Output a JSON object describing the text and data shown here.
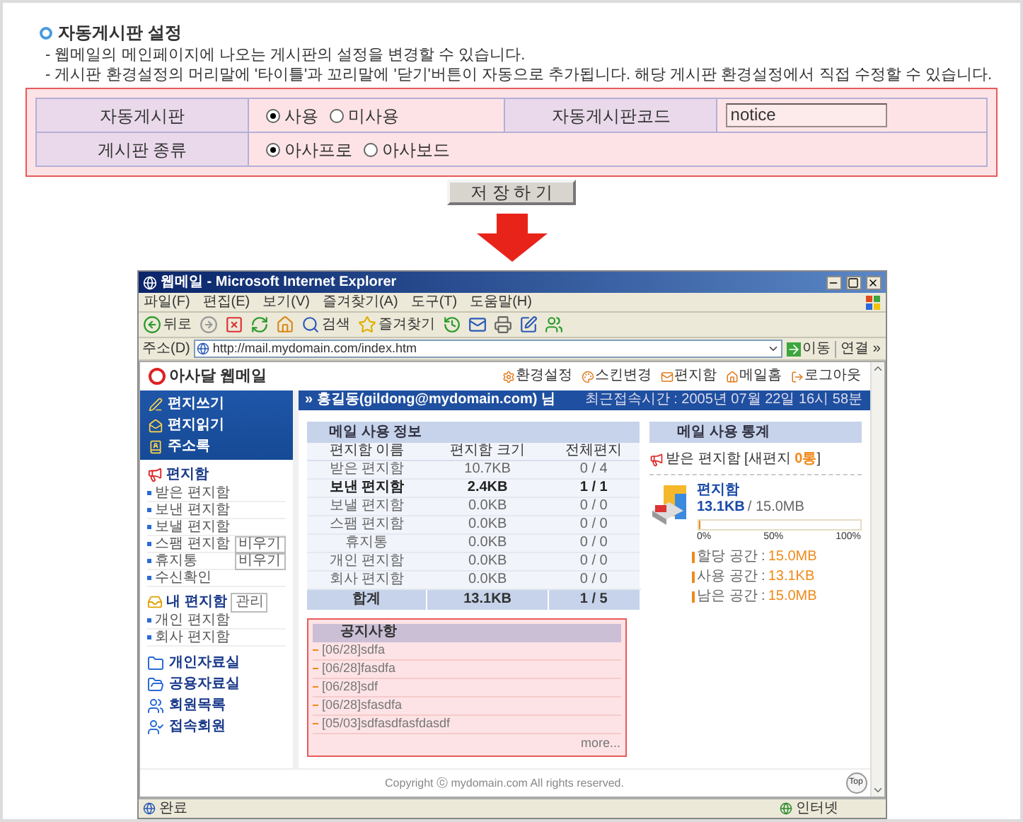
{
  "section": {
    "title": "자동게시판 설정",
    "notes": [
      "- 웹메일의 메인페이지에 나오는 게시판의 설정을 변경할 수 있습니다.",
      "- 게시판 환경설정의 머리말에 '타이틀'과 꼬리말에 '닫기'버튼이 자동으로 추가됩니다. 해당 게시판 환경설정에서 직접 수정할 수 있습니다."
    ]
  },
  "form": {
    "rows": [
      {
        "fields": [
          {
            "kind": "radio",
            "label": "자동게시판",
            "options": [
              {
                "label": "사용",
                "selected": true
              },
              {
                "label": "미사용",
                "selected": false
              }
            ]
          },
          {
            "kind": "text",
            "label": "자동게시판코드",
            "value": "notice"
          }
        ]
      },
      {
        "fields": [
          {
            "kind": "radio",
            "label": "게시판 종류",
            "options": [
              {
                "label": "아사프로",
                "selected": true
              },
              {
                "label": "아사보드",
                "selected": false
              }
            ]
          }
        ]
      }
    ]
  },
  "save_button": "저 장 하 기",
  "browser": {
    "title": "웹메일 - Microsoft Internet Explorer",
    "menu": [
      "파일(F)",
      "편집(E)",
      "보기(V)",
      "즐겨찾기(A)",
      "도구(T)",
      "도움말(H)"
    ],
    "toolbar": [
      {
        "kind": "back",
        "label": "뒤로"
      },
      {
        "kind": "forward"
      },
      {
        "kind": "stop"
      },
      {
        "kind": "refresh"
      },
      {
        "kind": "home"
      },
      {
        "kind": "search",
        "label": "검색"
      },
      {
        "kind": "favorites",
        "label": "즐겨찾기"
      },
      {
        "kind": "history"
      },
      {
        "kind": "mail"
      },
      {
        "kind": "print"
      },
      {
        "kind": "edit"
      },
      {
        "kind": "messenger"
      }
    ],
    "address": {
      "label": "주소(D)",
      "url": "http://mail.mydomain.com/index.htm",
      "go": "이동",
      "links": "연결 »"
    },
    "site": {
      "logo": "아사달 웹메일",
      "links": [
        "환경설정",
        "스킨변경",
        "편지함",
        "메일홈",
        "로그아웃"
      ],
      "user": "» 홍길동(gildong@mydomain.com) 님",
      "last_login": "최근접속시간 : 2005년 07월 22일 16시 58분"
    },
    "sidebar": {
      "menu_buttons": [
        "편지쓰기",
        "편지읽기",
        "주소록"
      ],
      "groups": [
        {
          "title": "편지함",
          "items": [
            {
              "label": "받은 편지함"
            },
            {
              "label": "보낸 편지함"
            },
            {
              "label": "보낼 편지함"
            },
            {
              "label": "스팸 편지함",
              "action": "비우기"
            },
            {
              "label": "휴지통",
              "action": "비우기"
            },
            {
              "label": "수신확인"
            }
          ]
        },
        {
          "title": "내 편지함",
          "badge": "관리",
          "items": [
            {
              "label": "개인 편지함"
            },
            {
              "label": "회사 편지함"
            }
          ]
        }
      ],
      "tools": [
        "개인자료실",
        "공용자료실",
        "회원목록",
        "접속회원"
      ]
    },
    "usage": {
      "title": "메일 사용 정보",
      "columns": [
        "편지함 이름",
        "편지함 크기",
        "전체편지"
      ],
      "rows": [
        {
          "cells": [
            "받은 편지함",
            "10.7KB",
            "0 / 4"
          ],
          "bold": false
        },
        {
          "cells": [
            "보낸 편지함",
            "2.4KB",
            "1 / 1"
          ],
          "bold": true
        },
        {
          "cells": [
            "보낼 편지함",
            "0.0KB",
            "0 / 0"
          ],
          "bold": false
        },
        {
          "cells": [
            "스팸 편지함",
            "0.0KB",
            "0 / 0"
          ],
          "bold": false
        },
        {
          "cells": [
            "휴지통",
            "0.0KB",
            "0 / 0"
          ],
          "bold": false
        },
        {
          "cells": [
            "개인 편지함",
            "0.0KB",
            "0 / 0"
          ],
          "bold": false
        },
        {
          "cells": [
            "회사 편지함",
            "0.0KB",
            "0 / 0"
          ],
          "bold": false
        }
      ],
      "total": [
        "합계",
        "13.1KB",
        "1 / 5"
      ]
    },
    "stats": {
      "title": "메일 사용 통계",
      "inbox": "받은 편지함 [새편지",
      "new_count": "0통",
      "inbox_end": "]",
      "mailbox": "편지함",
      "used": "13.1KB",
      "quota": "/ 15.0MB",
      "level": 0.01,
      "ticks": [
        "0%",
        "50%",
        "100%"
      ],
      "details": [
        {
          "label": "할당 공간 :",
          "value": "15.0MB"
        },
        {
          "label": "사용 공간 :",
          "value": "13.1KB"
        },
        {
          "label": "남은 공간 :",
          "value": "15.0MB"
        }
      ]
    },
    "notices": {
      "title": "공지사항",
      "items": [
        "[06/28]sdfa",
        "[06/28]fasdfa",
        "[06/28]sdf",
        "[06/28]sfasdfa",
        "[05/03]sdfasdfasfdasdf"
      ],
      "more": "more..."
    },
    "footer": "Copyright ⓒ mydomain.com All rights reserved.",
    "top_button": "Top",
    "status": {
      "text": "완료",
      "zone": "인터넷"
    }
  }
}
